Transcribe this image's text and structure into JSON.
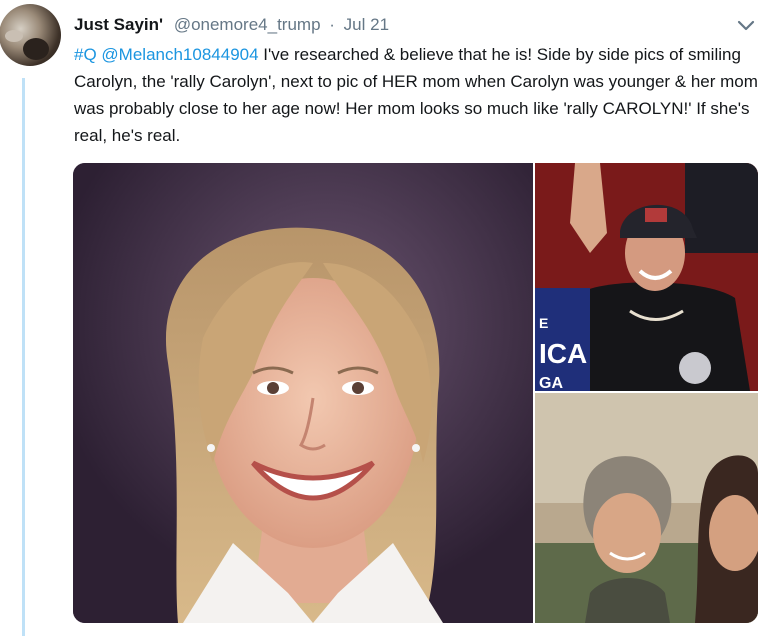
{
  "tweet": {
    "author_name": "Just Sayin'",
    "author_handle": "@onemore4_trump",
    "separator": "·",
    "date": "Jul 21",
    "hashtag": "#Q",
    "mention": "@Melanch10844904",
    "body": " I've researched & believe that he is! Side by side pics of smiling Carolyn, the 'rally Carolyn', next to pic of HER mom when Carolyn was younger & her mom was probably close to her age now! Her mom looks so much like 'rally CAROLYN!'  If she's real, he's real."
  },
  "media": {
    "count": 3,
    "photo_top_sign_text": "ICA",
    "photo_top_sign_text2": "GA",
    "photo_top_sign_letter": "E"
  },
  "colors": {
    "link": "#1b95e0",
    "thread_line": "#bfe1f7",
    "secondary_text": "#657786",
    "primary_text": "#14171a"
  },
  "icons": {
    "menu": "chevron-down-icon"
  }
}
